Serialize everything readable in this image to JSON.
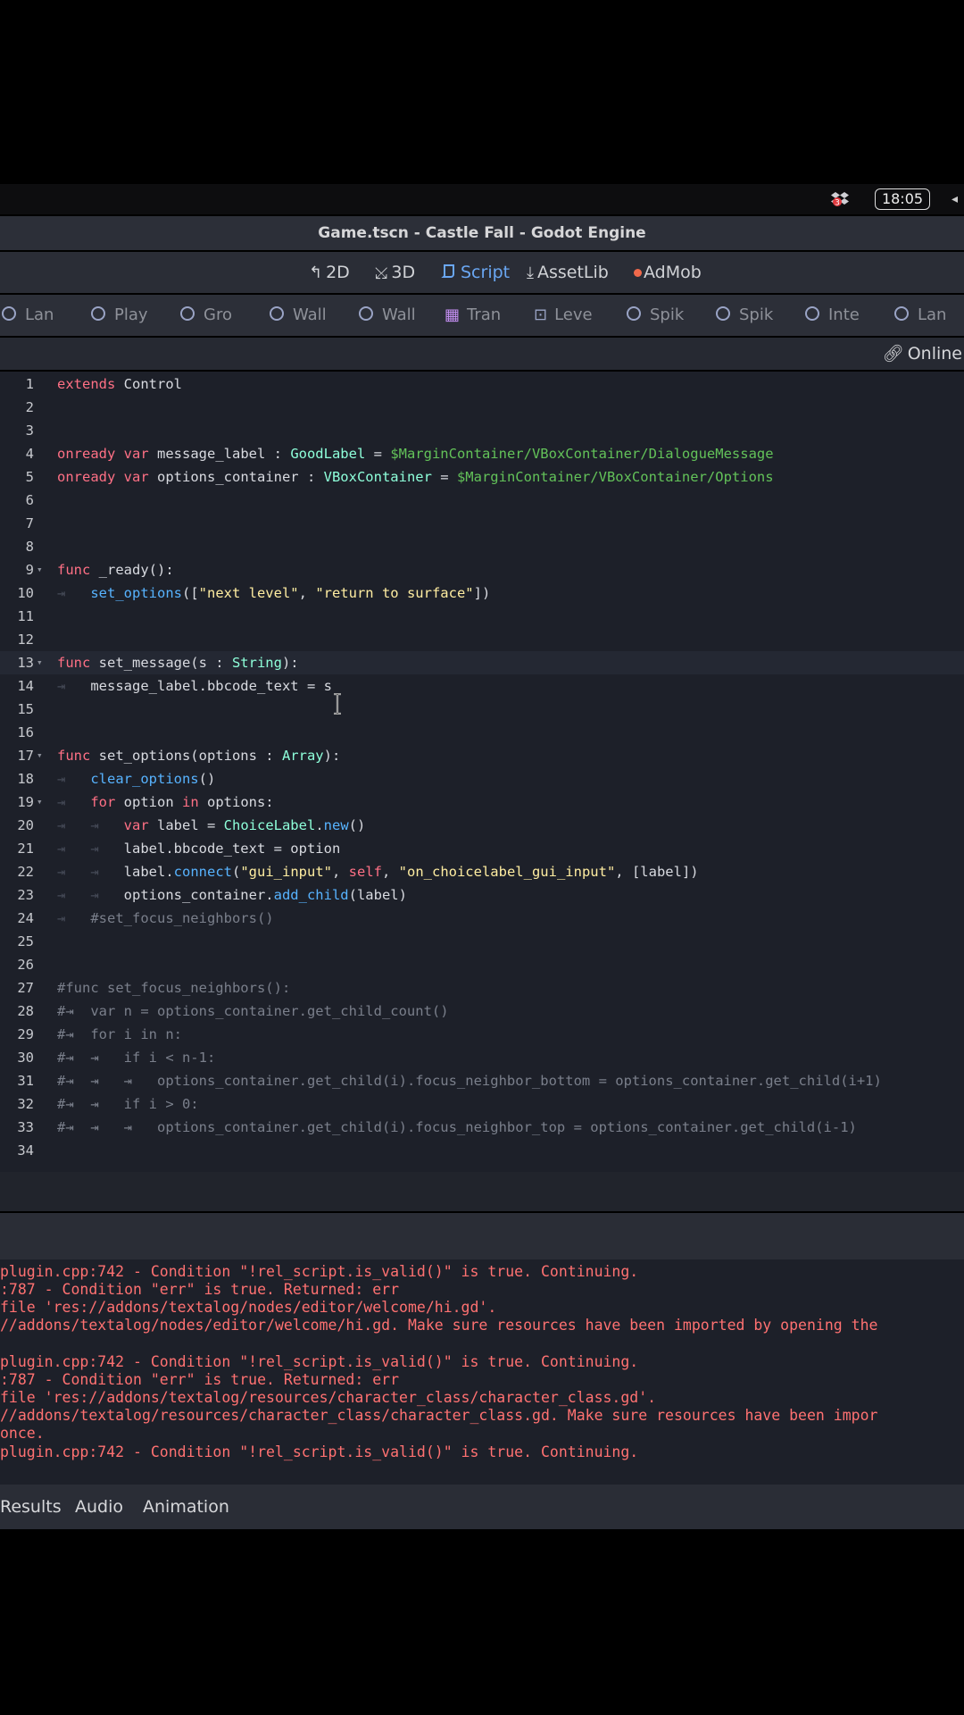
{
  "menubar": {
    "time": "18:05",
    "dropbox_icon": "dropbox-icon",
    "dropbox_badge": "3"
  },
  "window": {
    "title": "Game.tscn - Castle Fall - Godot Engine"
  },
  "main_tabs": [
    {
      "label": "2D",
      "icon": "2d-icon"
    },
    {
      "label": "3D",
      "icon": "3d-icon"
    },
    {
      "label": "Script",
      "icon": "script-icon",
      "active": true
    },
    {
      "label": "AssetLib",
      "icon": "assetlib-icon"
    },
    {
      "label": "AdMob",
      "icon": "admob-icon"
    }
  ],
  "scene_tabs": [
    "Lan",
    "Play",
    "Gro",
    "Wall",
    "Wall",
    "Tran",
    "Leve",
    "Spik",
    "Spik",
    "Inte",
    "Lan"
  ],
  "script_toolbar": {
    "online_label": "Online"
  },
  "code": {
    "line_numbers": [
      "1",
      "2",
      "3",
      "4",
      "5",
      "6",
      "7",
      "8",
      "9",
      "10",
      "11",
      "12",
      "13",
      "14",
      "15",
      "16",
      "17",
      "18",
      "19",
      "20",
      "21",
      "22",
      "23",
      "24",
      "25",
      "26",
      "27",
      "28",
      "29",
      "30",
      "31",
      "32",
      "33",
      "34"
    ],
    "l1": [
      "extends",
      " Control"
    ],
    "l4": [
      "onready",
      " ",
      "var",
      " message_label : ",
      "GoodLabel",
      " = ",
      "$MarginContainer/VBoxContainer/DialogueMessage"
    ],
    "l5": [
      "onready",
      " ",
      "var",
      " options_container : ",
      "VBoxContainer",
      " = ",
      "$MarginContainer/VBoxContainer/Options"
    ],
    "l9": [
      "func",
      " _ready():"
    ],
    "l10": [
      "set_options",
      "([",
      "\"next level\"",
      ", ",
      "\"return to surface\"",
      "])"
    ],
    "l13": [
      "func",
      " set_message(s : ",
      "String",
      "):"
    ],
    "l14": [
      "message_label.bbcode_text = s"
    ],
    "l17": [
      "func",
      " set_options(options : ",
      "Array",
      "):"
    ],
    "l18": [
      "clear_options",
      "()"
    ],
    "l19": [
      "for",
      " option ",
      "in",
      " options:"
    ],
    "l20": [
      "var",
      " label = ",
      "ChoiceLabel",
      ".",
      "new",
      "()"
    ],
    "l21": [
      "label.bbcode_text = option"
    ],
    "l22": [
      "label.",
      "connect",
      "(",
      "\"gui_input\"",
      ", ",
      "self",
      ", ",
      "\"on_choicelabel_gui_input\"",
      ", [label])"
    ],
    "l23": [
      "options_container.",
      "add_child",
      "(label)"
    ],
    "l24": [
      "#set_focus_neighbors()"
    ],
    "l27": [
      "#func set_focus_neighbors():"
    ],
    "l28": [
      "var n = options_container.get_child_count()"
    ],
    "l29": [
      "for i in n:"
    ],
    "l30": [
      "if i < n-1:"
    ],
    "l31": [
      "options_container.get_child(i).focus_neighbor_bottom = options_container.get_child(i+1)"
    ],
    "l32": [
      "if i > 0:"
    ],
    "l33": [
      "options_container.get_child(i).focus_neighbor_top = options_container.get_child(i-1)"
    ]
  },
  "output_lines": [
    "plugin.cpp:742 - Condition \"!rel_script.is_valid()\" is true. Continuing.",
    ":787 - Condition \"err\" is true. Returned: err",
    "file 'res://addons/textalog/nodes/editor/welcome/hi.gd'.",
    "//addons/textalog/nodes/editor/welcome/hi.gd. Make sure resources have been imported by opening the",
    "plugin.cpp:742 - Condition \"!rel_script.is_valid()\" is true. Continuing.",
    ":787 - Condition \"err\" is true. Returned: err",
    "file 'res://addons/textalog/resources/character_class/character_class.gd'.",
    "//addons/textalog/resources/character_class/character_class.gd. Make sure resources have been impor",
    "once.",
    "plugin.cpp:742 - Condition \"!rel_script.is_valid()\" is true. Continuing."
  ],
  "bottom_tabs": [
    "Results",
    "Audio",
    "Animation"
  ],
  "colors": {
    "keyword": "#ff7085",
    "function": "#57b3ff",
    "string": "#ffeda1",
    "type": "#8effda",
    "nodepath": "#63c259",
    "comment": "#7a7f8b",
    "error": "#ff7171",
    "accent": "#6aa7f3"
  }
}
